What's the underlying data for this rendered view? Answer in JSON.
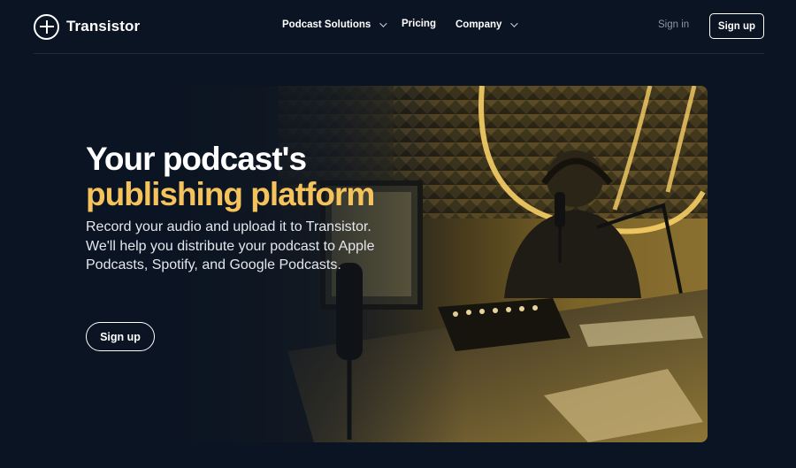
{
  "header": {
    "brand": "Transistor",
    "nav": {
      "solutions_label": "Podcast Solutions",
      "pricing_label": "Pricing",
      "company_label": "Company"
    },
    "signin_label": "Sign in",
    "signup_label": "Sign up"
  },
  "hero": {
    "title_line1": "Your podcast's",
    "title_line2": "publishing platform",
    "subtitle": "Record your audio and upload it to Transistor. We'll help you distribute your podcast to Apple Podcasts, Spotify, and Google Podcasts.",
    "cta_label": "Sign up"
  },
  "colors": {
    "background": "#0b1422",
    "accent": "#f5c35c",
    "text": "#ffffff"
  },
  "icons": {
    "logo": "transistor-logo-icon",
    "dropdown": "chevron-down-icon"
  }
}
